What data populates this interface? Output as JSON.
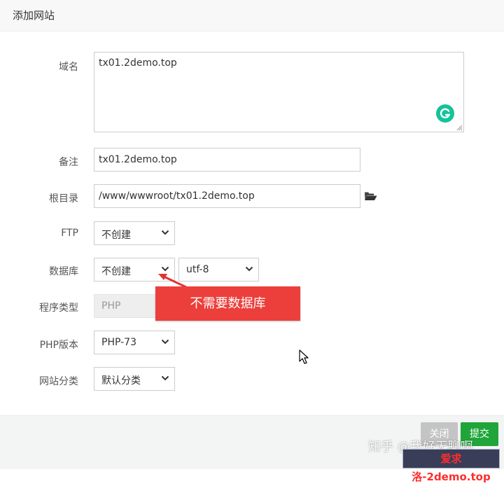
{
  "dialog": {
    "title": "添加网站"
  },
  "form": {
    "domain": {
      "label": "域名",
      "value": "tx01.2demo.top"
    },
    "remark": {
      "label": "备注",
      "value": "tx01.2demo.top"
    },
    "root_dir": {
      "label": "根目录",
      "value": "/www/wwwroot/tx01.2demo.top"
    },
    "ftp": {
      "label": "FTP",
      "value": "不创建"
    },
    "database": {
      "label": "数据库",
      "value": "不创建",
      "charset": "utf-8"
    },
    "program_type": {
      "label": "程序类型",
      "value": "PHP"
    },
    "php_version": {
      "label": "PHP版本",
      "value": "PHP-73"
    },
    "site_category": {
      "label": "网站分类",
      "value": "默认分类"
    }
  },
  "annotation": {
    "text": "不需要数据库",
    "color": "#ec3f3b"
  },
  "footer": {
    "close_label": "关闭",
    "submit_label": "提交",
    "submit_color": "#20a53a"
  },
  "watermark": {
    "zhihu": "知乎 @我好无聊啊",
    "stamp": "爱求洛-2demo.top"
  },
  "icons": {
    "grammarly": "grammarly-icon",
    "folder": "folder-open-icon",
    "chevron": "chevron-down-icon"
  }
}
